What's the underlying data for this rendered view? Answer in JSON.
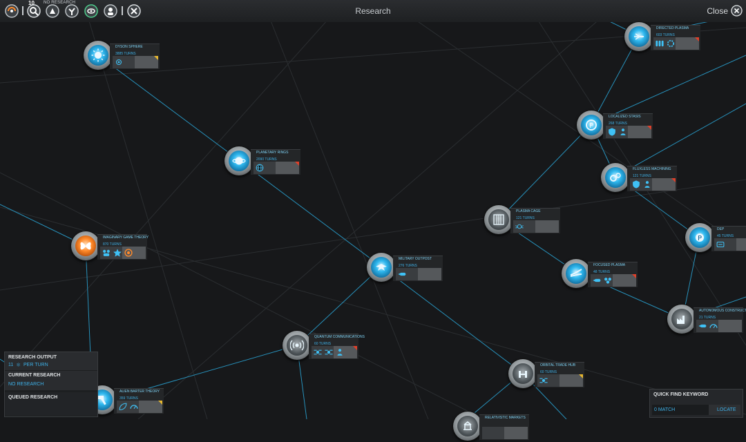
{
  "header": {
    "title": "Research",
    "research_count": "10",
    "research_status": "NO RESEARCH",
    "close_label": "Close"
  },
  "top_icons": [
    "empire-icon",
    "research-icon",
    "diplomacy-icon",
    "planets-icon",
    "trade-icon",
    "operations-icon",
    "close-icon"
  ],
  "nodes": [
    {
      "id": "dyson-sphere",
      "name": "DYSON SPHERE",
      "turns": "3885 TURNS",
      "style": "blue"
    },
    {
      "id": "planetary-rings",
      "name": "PLANETARY RINGS",
      "turns": "2090 TURNS",
      "style": "blue"
    },
    {
      "id": "imaginary-game-theory",
      "name": "IMAGINARY GAME THEORY",
      "turns": "870 TURNS",
      "style": "orange"
    },
    {
      "id": "military-outpost",
      "name": "MILITARY OUTPOST",
      "turns": "276 TURNS",
      "style": "blue"
    },
    {
      "id": "quantum-communications",
      "name": "QUANTUM COMMUNICATIONS",
      "turns": "60 TURNS",
      "style": "gray"
    },
    {
      "id": "alien-barter-theory",
      "name": "ALIEN BARTER THEORY",
      "turns": "359 TURNS",
      "style": "blue"
    },
    {
      "id": "directed-plasma",
      "name": "DIRECTED PLASMA",
      "turns": "603 TURNS",
      "style": "blue"
    },
    {
      "id": "localized-stasis",
      "name": "LOCALIZED STASIS",
      "turns": "268 TURNS",
      "style": "blue"
    },
    {
      "id": "fluxless-machining",
      "name": "FLUXLESS MACHINING",
      "turns": "121 TURNS",
      "style": "blue"
    },
    {
      "id": "plasma-cage",
      "name": "PLASMA CAGE",
      "turns": "121 TURNS",
      "style": "gray"
    },
    {
      "id": "focused-plasma",
      "name": "FOCUSED PLASMA",
      "turns": "48 TURNS",
      "style": "blue"
    },
    {
      "id": "dep",
      "name": "DEP",
      "turns": "45 TURNS",
      "style": "blue"
    },
    {
      "id": "autonomous-construction",
      "name": "AUTONOMOUS CONSTRUCTION",
      "turns": "21 TURNS",
      "style": "gray"
    },
    {
      "id": "orbital-trade-hub",
      "name": "ORBITAL TRADE HUB",
      "turns": "60 TURNS",
      "style": "gray"
    },
    {
      "id": "relativistic-markets",
      "name": "RELATIVISTIC MARKETS",
      "turns": "",
      "style": "gray"
    }
  ],
  "research_panel": {
    "output_header": "RESEARCH OUTPUT",
    "output_value": "11",
    "output_suffix": "PER TURN",
    "current_header": "CURRENT RESEARCH",
    "current_value": "NO RESEARCH",
    "queued_header": "QUEUED RESEARCH"
  },
  "quick_find": {
    "title": "QUICK FIND KEYWORD",
    "match": "0 MATCH",
    "locate": "LOCATE"
  },
  "colors": {
    "accent": "#3eb2ea",
    "line": "#2aa7d8",
    "flag_red": "#e0402a",
    "flag_yellow": "#e8b830"
  }
}
